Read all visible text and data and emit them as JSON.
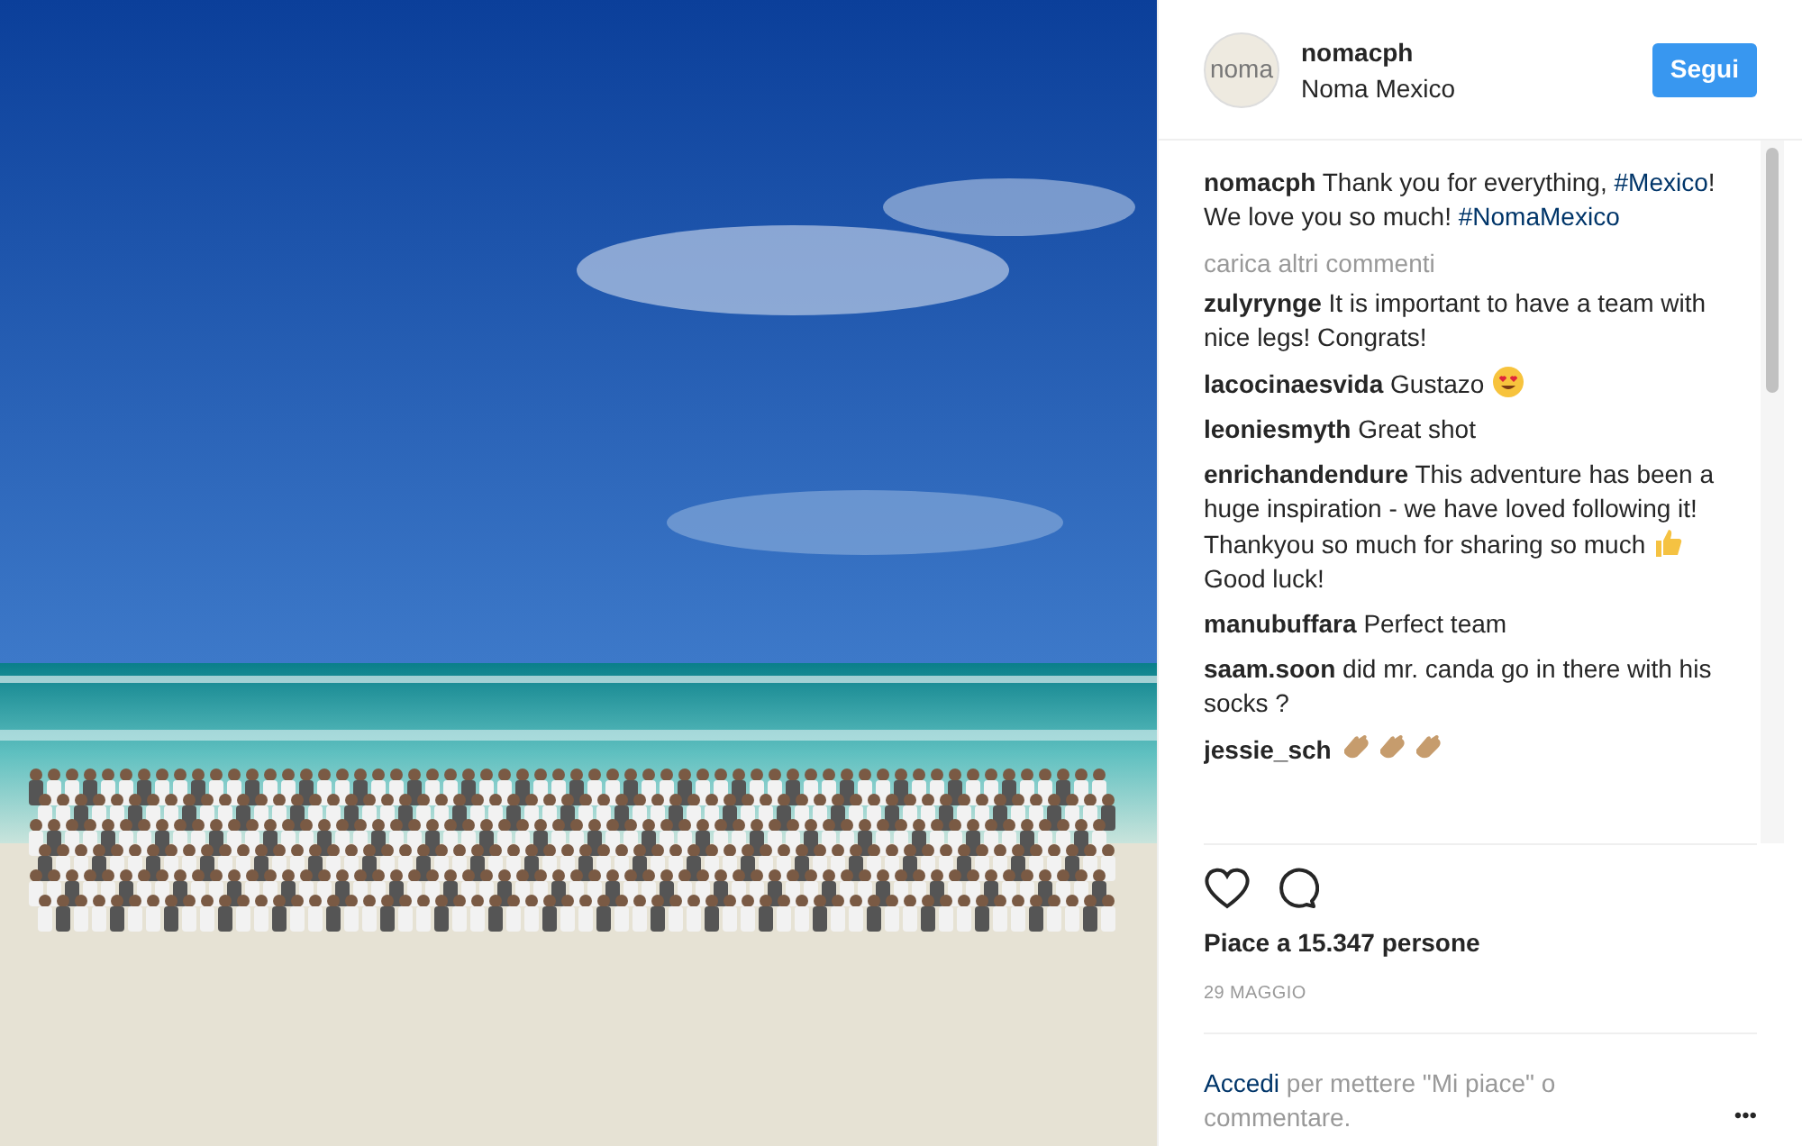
{
  "post": {
    "username": "nomacph",
    "location": "Noma Mexico",
    "avatar_text": "noma",
    "follow_button": "Segui"
  },
  "caption": {
    "username": "nomacph",
    "parts": [
      {
        "kind": "text",
        "text": "Thank you for everything, "
      },
      {
        "kind": "hashtag",
        "text": "#Mexico"
      },
      {
        "kind": "text",
        "text": "! We love you so much! "
      },
      {
        "kind": "hashtag",
        "text": "#NomaMexico"
      }
    ]
  },
  "load_more": "carica altri commenti",
  "comments": [
    {
      "username": "zulyrynge",
      "parts": [
        {
          "kind": "text",
          "text": "It is important to have a team with nice legs! Congrats!"
        }
      ]
    },
    {
      "username": "lacocinaesvida",
      "parts": [
        {
          "kind": "text",
          "text": "Gustazo "
        },
        {
          "kind": "heart-eyes"
        }
      ]
    },
    {
      "username": "leoniesmyth",
      "parts": [
        {
          "kind": "text",
          "text": "Great shot"
        }
      ]
    },
    {
      "username": "enrichandendure",
      "parts": [
        {
          "kind": "text",
          "text": "This adventure has been a huge inspiration - we have loved following it! Thankyou so much for sharing so much "
        },
        {
          "kind": "thumbs"
        },
        {
          "kind": "text",
          "text": " Good luck!"
        }
      ]
    },
    {
      "username": "manubuffara",
      "parts": [
        {
          "kind": "text",
          "text": "Perfect team"
        }
      ]
    },
    {
      "username": "saam.soon",
      "parts": [
        {
          "kind": "text",
          "text": "did mr. canda go in there with his socks ?"
        }
      ]
    },
    {
      "username": "jessie_sch",
      "parts": [
        {
          "kind": "clap"
        },
        {
          "kind": "clap"
        },
        {
          "kind": "clap"
        }
      ]
    }
  ],
  "likes": "Piace a 15.347 persone",
  "date": "29 MAGGIO",
  "login": {
    "link": "Accedi",
    "text": " per mettere \"Mi piace\" o commentare."
  },
  "more_button": "•••"
}
